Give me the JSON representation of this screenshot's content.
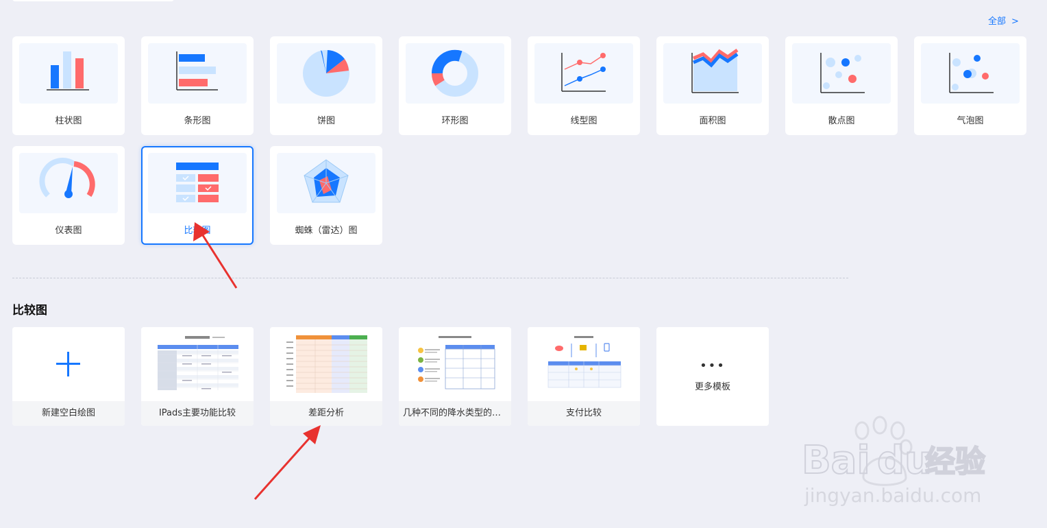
{
  "header": {
    "all_label": "全部",
    "all_chevron": ">"
  },
  "chart_types": [
    {
      "label": "柱状图",
      "icon": "bar-chart-icon"
    },
    {
      "label": "条形图",
      "icon": "horizontal-bar-chart-icon"
    },
    {
      "label": "饼图",
      "icon": "pie-chart-icon"
    },
    {
      "label": "环形图",
      "icon": "donut-chart-icon"
    },
    {
      "label": "线型图",
      "icon": "line-chart-icon"
    },
    {
      "label": "面积图",
      "icon": "area-chart-icon"
    },
    {
      "label": "散点图",
      "icon": "scatter-chart-icon"
    },
    {
      "label": "气泡图",
      "icon": "bubble-chart-icon"
    },
    {
      "label": "仪表图",
      "icon": "gauge-chart-icon"
    },
    {
      "label": "比较图",
      "icon": "comparison-chart-icon",
      "selected": true
    },
    {
      "label": "蜘蛛（雷达）图",
      "icon": "radar-chart-icon"
    }
  ],
  "section": {
    "title": "比较图",
    "templates": [
      {
        "label": "新建空白绘图",
        "preview": "plus-icon"
      },
      {
        "label": "IPads主要功能比较",
        "preview": "ipad-comparison-table"
      },
      {
        "label": "差距分析",
        "preview": "gap-analysis-table"
      },
      {
        "label": "几种不同的降水类型的比...",
        "preview": "precipitation-comparison"
      },
      {
        "label": "支付比较",
        "preview": "payment-comparison"
      }
    ],
    "more": {
      "dots": "•••",
      "label": "更多模板"
    }
  },
  "colors": {
    "accent": "#1677ff",
    "light_blue": "#c9e3ff",
    "red": "#ff6b6b",
    "bg": "#eeeff6"
  },
  "watermark": {
    "brand": "Bai",
    "brand2": "du",
    "cn": "经验",
    "url": "jingyan.baidu.com"
  }
}
